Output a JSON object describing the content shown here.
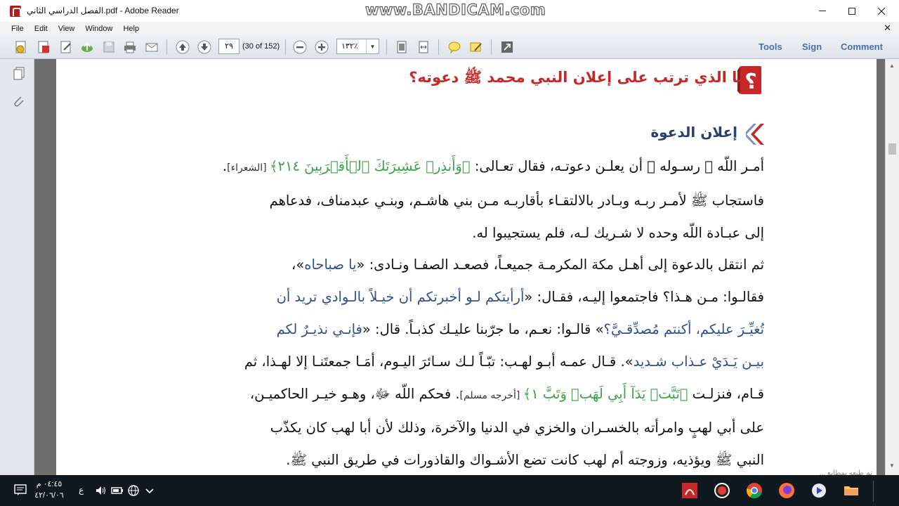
{
  "window": {
    "title": "الفصل الدراسي الثاني.pdf - Adobe Reader",
    "watermark": "www.BANDICAM.com"
  },
  "menu": {
    "items": [
      "File",
      "Edit",
      "View",
      "Window",
      "Help"
    ]
  },
  "toolbar": {
    "page_value": "٢٩",
    "page_count": "(30 of 152)",
    "zoom_value": "١٣٢٪",
    "tools_label": "Tools",
    "sign_label": "Sign",
    "comment_label": "Comment"
  },
  "document": {
    "question_title": "ما الذي ترتب على إعلان النبي محمد ﷺ دعوته؟",
    "section_title": "إعلان الدعوة",
    "lines": [
      {
        "p1": "أمـر اللّه ﷻ رسـوله ﷺ أن يعلـن دعوتـه، فقال تعـالى: ",
        "green": "﴿وَأَنذِرۡ عَشِيرَتَكَ ٱلۡأَقۡرَبِينَ ٢١٤﴾",
        "ref": " [الشعراء]",
        "p2": "."
      },
      {
        "p1": "فاستجاب ﷺ لأمـر ربـه وبـادر بالالتقـاء بأقاربـه مـن بني هاشـم، وبنـي عبدمناف، فدعاهم"
      },
      {
        "p1": "إلى عبـادة اللّه وحده لا شـريك لـه، فلم يستجيبوا له."
      },
      {
        "p1": "ثم انتقل بالدعوة إلى أهـل مكة المكرمـة جميعـاً، فصعـد الصفـا ونـادى: «",
        "blue": "يا صباحاه",
        "p2": "»،"
      },
      {
        "p1": "فقالـوا: مـن هـذا؟ فاجتمعوا إليـه، فقـال: «",
        "blue": "أرأيتكم لـو أخبرتكم أن خيـلاً بالـوادي تريد أن"
      },
      {
        "blue": "تُغيِّـرَ عليكم، أكنتم مُصدِّقـيَّ؟",
        "p1": "» قالـوا: نعـم، ما جرّبنا عليـك كذبـاً. قال: «",
        "blue2": "فإنـي نذيـرٌ لكم"
      },
      {
        "blue": "بيـن يَـدَيْ عـذاب شـديد",
        "p1": "». قـال عمـه أبـو لهـب: تبّـاً لـك سـائرَ اليـوم، أمَـا جمعتَنـا إلا لهـذا، ثم"
      },
      {
        "p1": "قـام، فنزلـت ",
        "green": "﴿تَبَّتۡ يَدَآ أَبِي لَهَبٖ وَتَبَّ ١﴾",
        "ref": " [أخرجه مسلم]",
        "p2": ". فحكم اللّه ﷻ، وهـو خيـر الحاكميـن،"
      },
      {
        "p1": "على أبي لهبٍ وامرأته بالخسـران والخزي في الدنيا والآخرة، وذلك لأن أبا لهب كان يكذّب"
      },
      {
        "p1": "النبي ﷺ ويؤذيه، وزوجته أم لهب كانت تضع الأشـواك والقاذورات في طريق النبي ﷺ."
      }
    ],
    "footer": "تم طبعه بمطابع ..."
  },
  "taskbar": {
    "time": "٠٤:٤٥ م",
    "date": "٤٢/٠٦/٠٦",
    "lang": "ع"
  },
  "colors": {
    "question_red": "#c62828",
    "section_blue": "#2c3e6b",
    "verse_green": "#3aa34a",
    "hadith_blue": "#2f4f8f"
  }
}
